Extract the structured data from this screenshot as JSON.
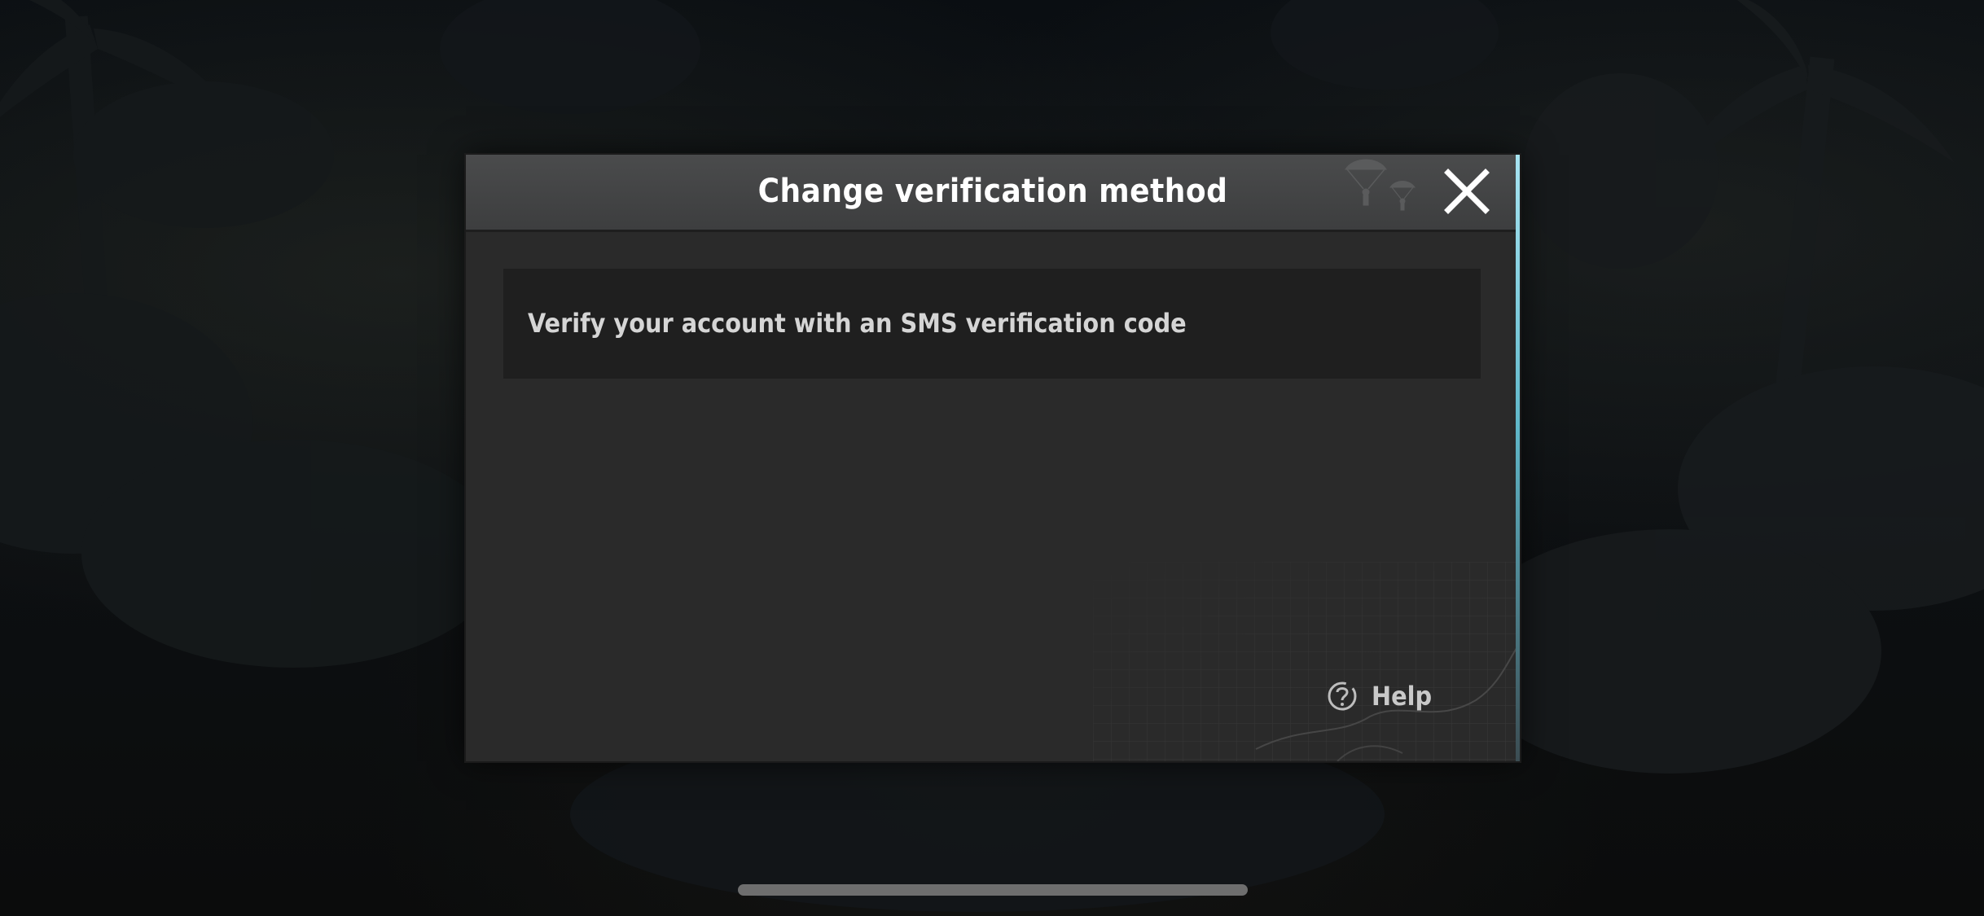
{
  "dialog": {
    "title": "Change verification method",
    "close_icon": "close-icon",
    "options": [
      {
        "label": "Verify your account with an SMS verification code"
      }
    ],
    "help": {
      "label": "Help",
      "icon": "help-circle-icon"
    }
  },
  "colors": {
    "dialog_bg": "#2a2a2a",
    "header_bg": "#434445",
    "option_bg": "#1f1f1f",
    "accent": "#8fd6e8"
  }
}
